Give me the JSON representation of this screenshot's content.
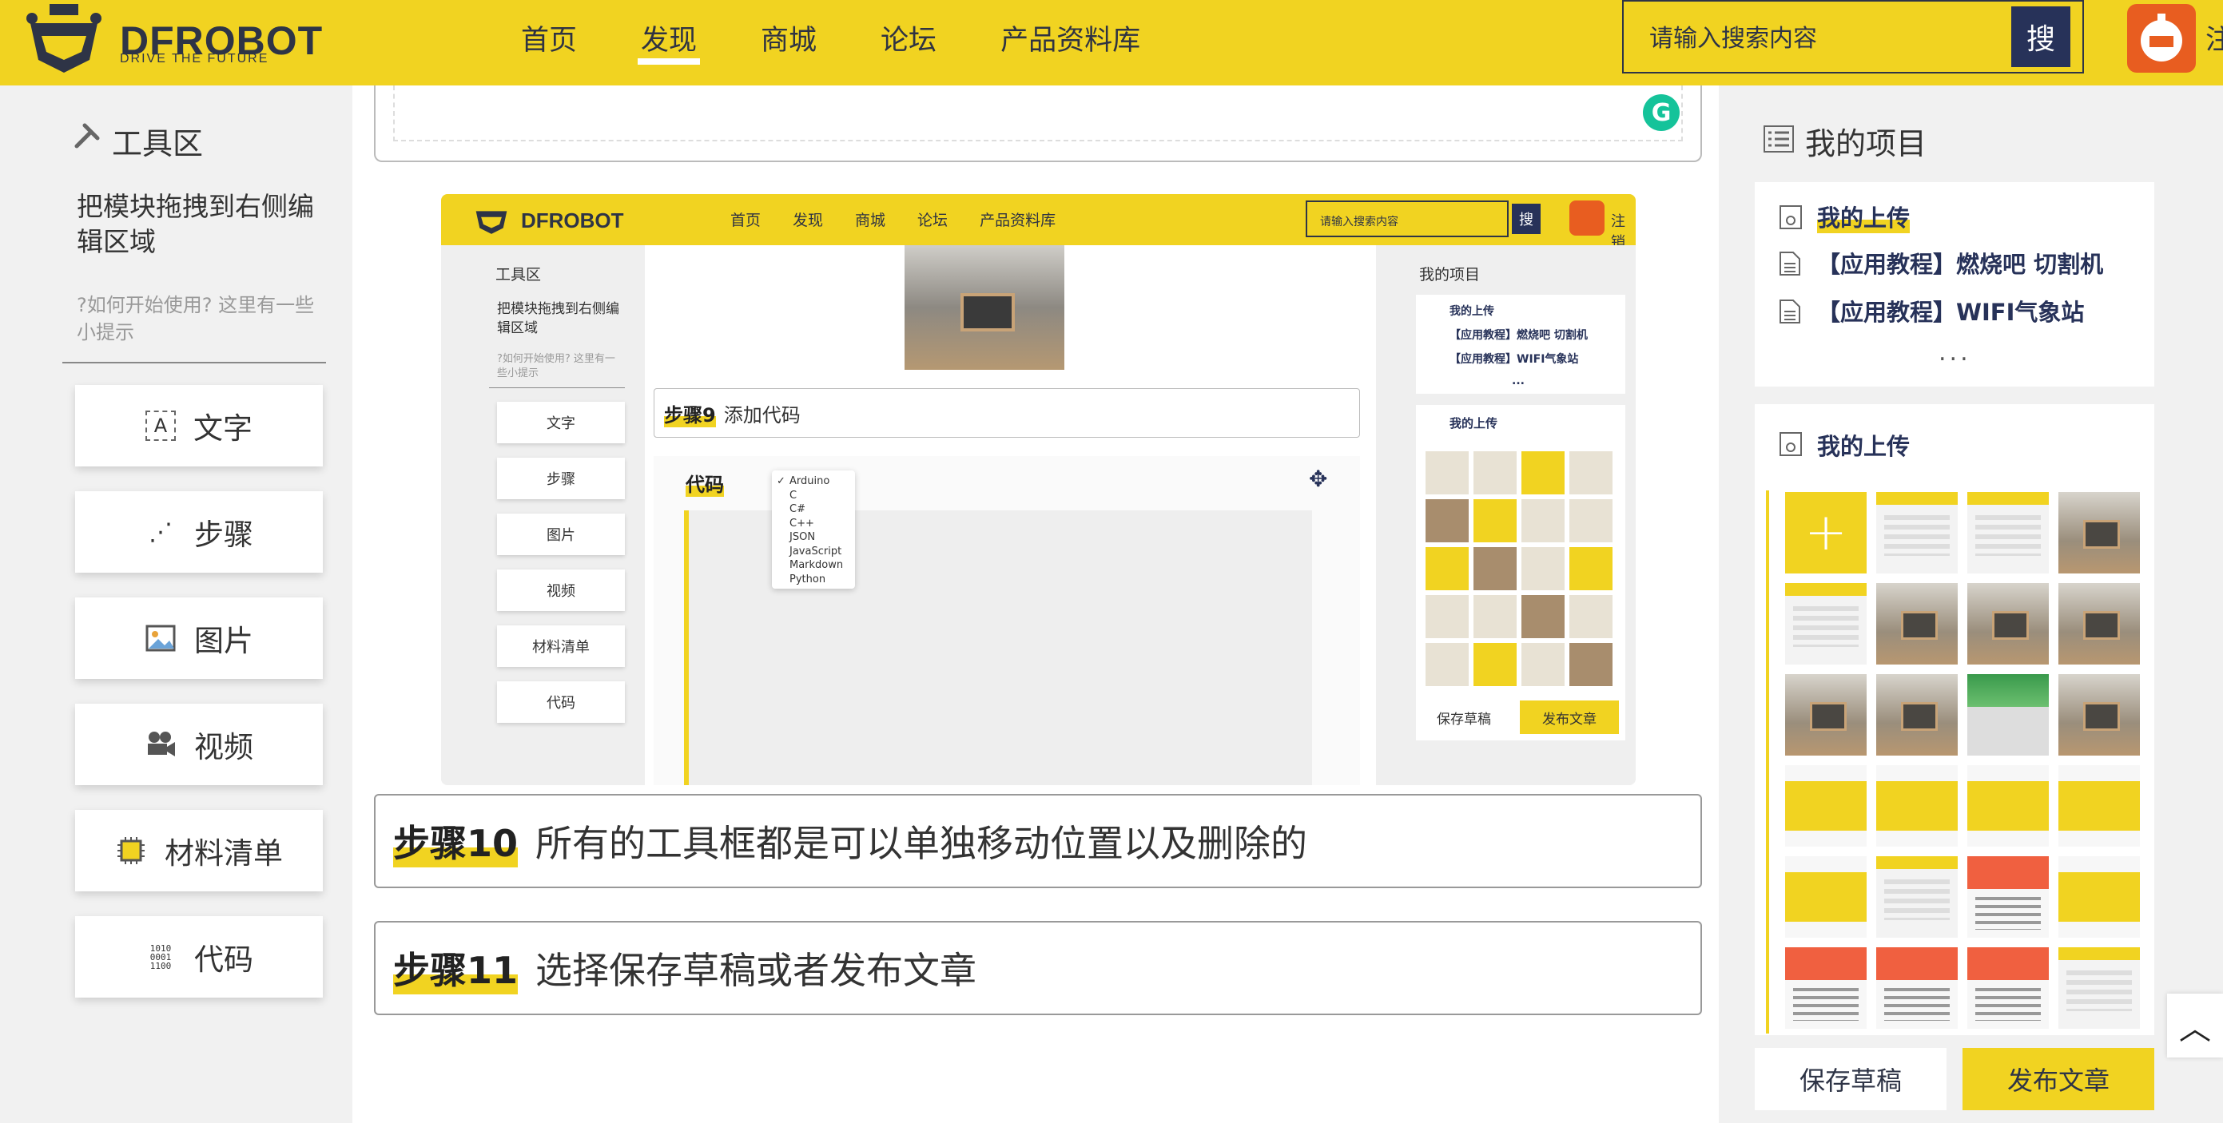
{
  "header": {
    "brand": "DFROBOT",
    "tagline": "DRIVE THE FUTURE",
    "nav": [
      "首页",
      "发现",
      "商城",
      "论坛",
      "产品资料库"
    ],
    "active_nav": "发现",
    "search_placeholder": "请输入搜索内容",
    "search_button": "搜",
    "register": "注"
  },
  "toolbox": {
    "title": "工具区",
    "hint": "把模块拖拽到右侧编辑区域",
    "help": "?如何开始使用? 这里有一些小提示",
    "tools": [
      {
        "label": "文字",
        "icon": "text-icon"
      },
      {
        "label": "步骤",
        "icon": "steps-icon"
      },
      {
        "label": "图片",
        "icon": "image-icon"
      },
      {
        "label": "视频",
        "icon": "video-icon"
      },
      {
        "label": "材料清单",
        "icon": "chip-icon"
      },
      {
        "label": "代码",
        "icon": "code-icon"
      }
    ]
  },
  "screenshot": {
    "brand": "DFROBOT",
    "nav": [
      "首页",
      "发现",
      "商城",
      "论坛",
      "产品资料库"
    ],
    "search_placeholder": "请输入搜索内容",
    "search_button": "搜",
    "register": "注销",
    "toolbox_title": "工具区",
    "hint": "把模块拖拽到右侧编辑区域",
    "help": "?如何开始使用? 这里有一些小提示",
    "tools": [
      "文字",
      "步骤",
      "图片",
      "视频",
      "材料清单",
      "代码"
    ],
    "step9_tag": "步骤9",
    "step9_text": "添加代码",
    "code_label": "代码",
    "languages": [
      "Arduino",
      "C",
      "C#",
      "C++",
      "JSON",
      "JavaScript",
      "Markdown",
      "Python"
    ],
    "selected_language": "Arduino",
    "projects_title": "我的项目",
    "uploads": [
      "我的上传",
      "【应用教程】燃烧吧 切割机",
      "【应用教程】WIFI气象站"
    ],
    "more": "...",
    "uploads_title": "我的上传",
    "save": "保存草稿",
    "publish": "发布文章"
  },
  "steps": [
    {
      "tag": "步骤10",
      "text": "所有的工具框都是可以单独移动位置以及删除的"
    },
    {
      "tag": "步骤11",
      "text": "选择保存草稿或者发布文章"
    }
  ],
  "projects": {
    "title": "我的项目",
    "items": [
      "我的上传",
      "【应用教程】燃烧吧 切割机",
      "【应用教程】WIFI气象站"
    ],
    "more": "...",
    "uploads_title": "我的上传",
    "add": "+"
  },
  "actions": {
    "save": "保存草稿",
    "publish": "发布文章"
  },
  "colors": {
    "brand_yellow": "#f1d321",
    "navy": "#273259",
    "avatar_orange": "#e85d20",
    "grammarly_green": "#15c39a"
  }
}
